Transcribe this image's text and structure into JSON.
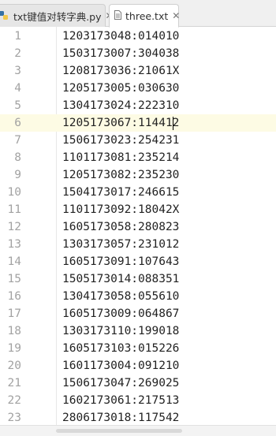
{
  "tabs": [
    {
      "label": "txt键值对转字典.py",
      "icon": "python-file-icon",
      "close": "✕",
      "active": false
    },
    {
      "label": "three.txt",
      "icon": "text-file-icon",
      "close": "✕",
      "active": true
    }
  ],
  "editor": {
    "current_line": 6,
    "lines": [
      {
        "n": "1",
        "text": "1203173048:014010"
      },
      {
        "n": "2",
        "text": "1503173007:304038"
      },
      {
        "n": "3",
        "text": "1208173036:21061X"
      },
      {
        "n": "4",
        "text": "1205173005:030630"
      },
      {
        "n": "5",
        "text": "1304173024:222310"
      },
      {
        "n": "6",
        "text": "1205173067:114412"
      },
      {
        "n": "7",
        "text": "1506173023:254231"
      },
      {
        "n": "8",
        "text": "1101173081:235214"
      },
      {
        "n": "9",
        "text": "1205173082:235230"
      },
      {
        "n": "10",
        "text": "1504173017:246615"
      },
      {
        "n": "11",
        "text": "1101173092:18042X"
      },
      {
        "n": "12",
        "text": "1605173058:280823"
      },
      {
        "n": "13",
        "text": "1303173057:231012"
      },
      {
        "n": "14",
        "text": "1605173091:107643"
      },
      {
        "n": "15",
        "text": "1505173014:088351"
      },
      {
        "n": "16",
        "text": "1304173058:055610"
      },
      {
        "n": "17",
        "text": "1605173009:064867"
      },
      {
        "n": "18",
        "text": "1303173110:199018"
      },
      {
        "n": "19",
        "text": "1605173103:015226"
      },
      {
        "n": "20",
        "text": "1601173004:091210"
      },
      {
        "n": "21",
        "text": "1506173047:269025"
      },
      {
        "n": "22",
        "text": "1602173061:217513"
      },
      {
        "n": "23",
        "text": "2806173018:117542"
      }
    ]
  },
  "colors": {
    "current_line_bg": "#fdfbe4",
    "gutter_text": "#a2a2a2",
    "code_text": "#222222"
  }
}
